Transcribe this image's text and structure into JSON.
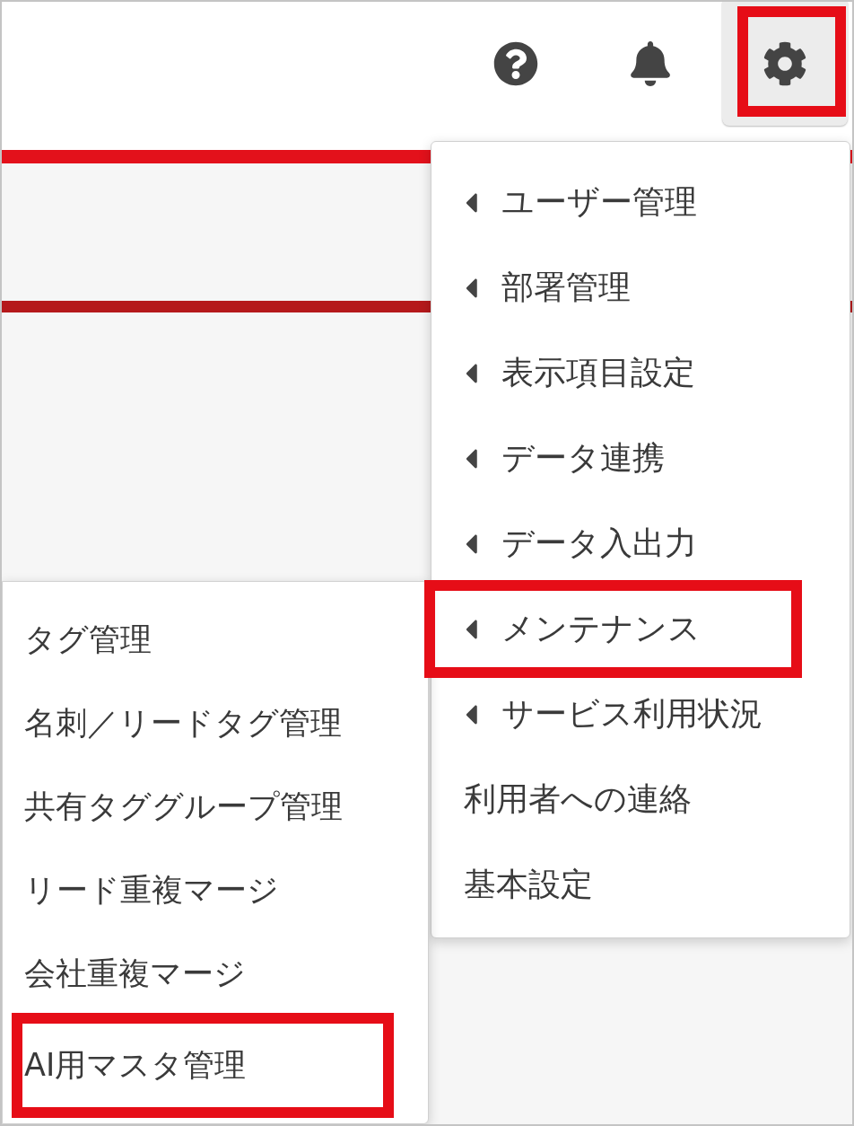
{
  "header": {
    "buttons": [
      {
        "kind": "help",
        "selected": false,
        "highlighted": false
      },
      {
        "kind": "notifications",
        "selected": false,
        "highlighted": false
      },
      {
        "kind": "settings",
        "selected": true,
        "highlighted": true
      }
    ]
  },
  "settings_menu": {
    "items": [
      {
        "label": "ユーザー管理",
        "has_submenu": true,
        "highlighted": false
      },
      {
        "label": "部署管理",
        "has_submenu": true,
        "highlighted": false
      },
      {
        "label": "表示項目設定",
        "has_submenu": true,
        "highlighted": false
      },
      {
        "label": "データ連携",
        "has_submenu": true,
        "highlighted": false
      },
      {
        "label": "データ入出力",
        "has_submenu": true,
        "highlighted": false
      },
      {
        "label": "メンテナンス",
        "has_submenu": true,
        "highlighted": true
      },
      {
        "label": "サービス利用状況",
        "has_submenu": true,
        "highlighted": false
      },
      {
        "label": "利用者への連絡",
        "has_submenu": false,
        "highlighted": false
      },
      {
        "label": "基本設定",
        "has_submenu": false,
        "highlighted": false
      }
    ]
  },
  "submenu": {
    "items": [
      {
        "label": "タグ管理",
        "highlighted": false
      },
      {
        "label": "名刺／リードタグ管理",
        "highlighted": false
      },
      {
        "label": "共有タググループ管理",
        "highlighted": false
      },
      {
        "label": "リード重複マージ",
        "highlighted": false
      },
      {
        "label": "会社重複マージ",
        "highlighted": false
      },
      {
        "label": "AI用マスタ管理",
        "highlighted": true
      }
    ]
  }
}
